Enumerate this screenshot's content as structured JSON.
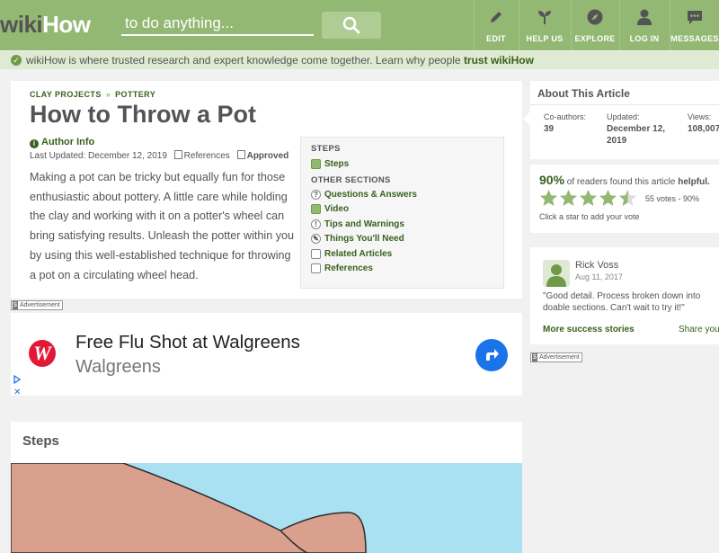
{
  "header": {
    "logo_wiki": "wiki",
    "logo_how": "How",
    "search_placeholder": "to do anything...",
    "nav": [
      {
        "label": "EDIT",
        "icon": "pencil-icon"
      },
      {
        "label": "HELP US",
        "icon": "sprout-icon"
      },
      {
        "label": "EXPLORE",
        "icon": "compass-icon"
      },
      {
        "label": "LOG IN",
        "icon": "user-icon"
      },
      {
        "label": "MESSAGES",
        "icon": "chat-bubble-icon"
      }
    ]
  },
  "trust": {
    "text": "wikiHow is where trusted research and expert knowledge come together. Learn why people ",
    "link": "trust wikiHow"
  },
  "article": {
    "breadcrumb": [
      "CLAY PROJECTS",
      "POTTERY"
    ],
    "breadcrumb_sep": "»",
    "title": "How to Throw a Pot",
    "author_info": "Author Info",
    "last_updated": "Last Updated: December 12, 2019",
    "references": "References",
    "approved": "Approved",
    "intro": "Making a pot can be tricky but equally fun for those enthusiastic about pottery. A little care while holding the clay and working with it on a potter's wheel can bring satisfying results. Unleash the potter within you by using this well-established technique for throwing a pot on a circulating wheel head."
  },
  "toc": {
    "steps_heading": "STEPS",
    "steps_item": "Steps",
    "other_heading": "OTHER SECTIONS",
    "items": [
      "Questions & Answers",
      "Video",
      "Tips and Warnings",
      "Things You'll Need",
      "Related Articles",
      "References"
    ]
  },
  "ad": {
    "tag": "Advertisement",
    "title": "Free Flu Shot at Walgreens",
    "advertiser": "Walgreens",
    "logo_letter": "W"
  },
  "steps_section": {
    "heading": "Steps"
  },
  "sidebar": {
    "about_heading": "About This Article",
    "coauthors_label": "Co-authors:",
    "coauthors_value": "39",
    "updated_label": "Updated:",
    "updated_value": "December 12, 2019",
    "views_label": "Views:",
    "views_value": "108,007",
    "helpful_pct": "90%",
    "helpful_text": " of readers found this article ",
    "helpful_word": "helpful.",
    "stars_filled": 4.5,
    "stars_total": 5,
    "votes": "55 votes - 90%",
    "click_star": "Click a star to add your vote",
    "reviewer_name": "Rick Voss",
    "review_date": "Aug 11, 2017",
    "review_quote": "\"Good detail. Process broken down into doable sections. Can't wait to try it!\"",
    "more_stories": "More success stories",
    "share": "Share yours!",
    "ad_tag": "Advertisement"
  },
  "colors": {
    "brand_green": "#93b874",
    "link_green": "#38611e",
    "star_green": "#93b874",
    "ad_blue": "#1a73e8",
    "walgreens_red": "#e31837"
  }
}
